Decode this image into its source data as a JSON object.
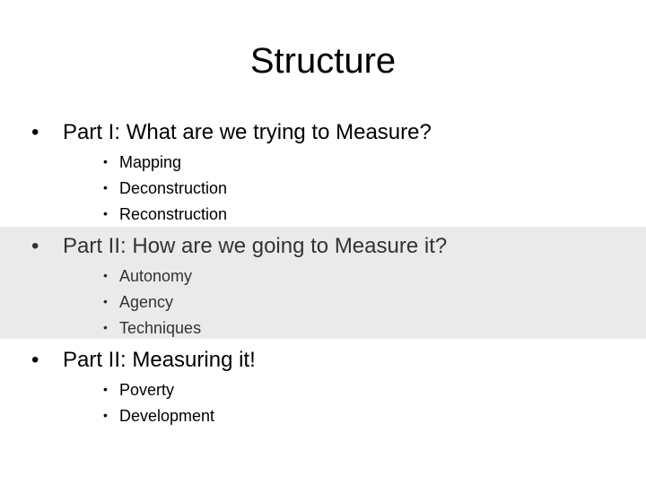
{
  "slide": {
    "title": "Structure",
    "highlight_color": "#eaeaea",
    "sections": [
      {
        "label": "Part I: What are we trying to Measure?",
        "items": [
          "Mapping",
          "Deconstruction",
          "Reconstruction"
        ],
        "highlighted": false
      },
      {
        "label": "Part II: How are we going to Measure it?",
        "items": [
          "Autonomy",
          "Agency",
          "Techniques"
        ],
        "highlighted": true
      },
      {
        "label": "Part II: Measuring it!",
        "items": [
          "Poverty",
          "Development"
        ],
        "highlighted": false
      }
    ],
    "bullet": "•"
  }
}
